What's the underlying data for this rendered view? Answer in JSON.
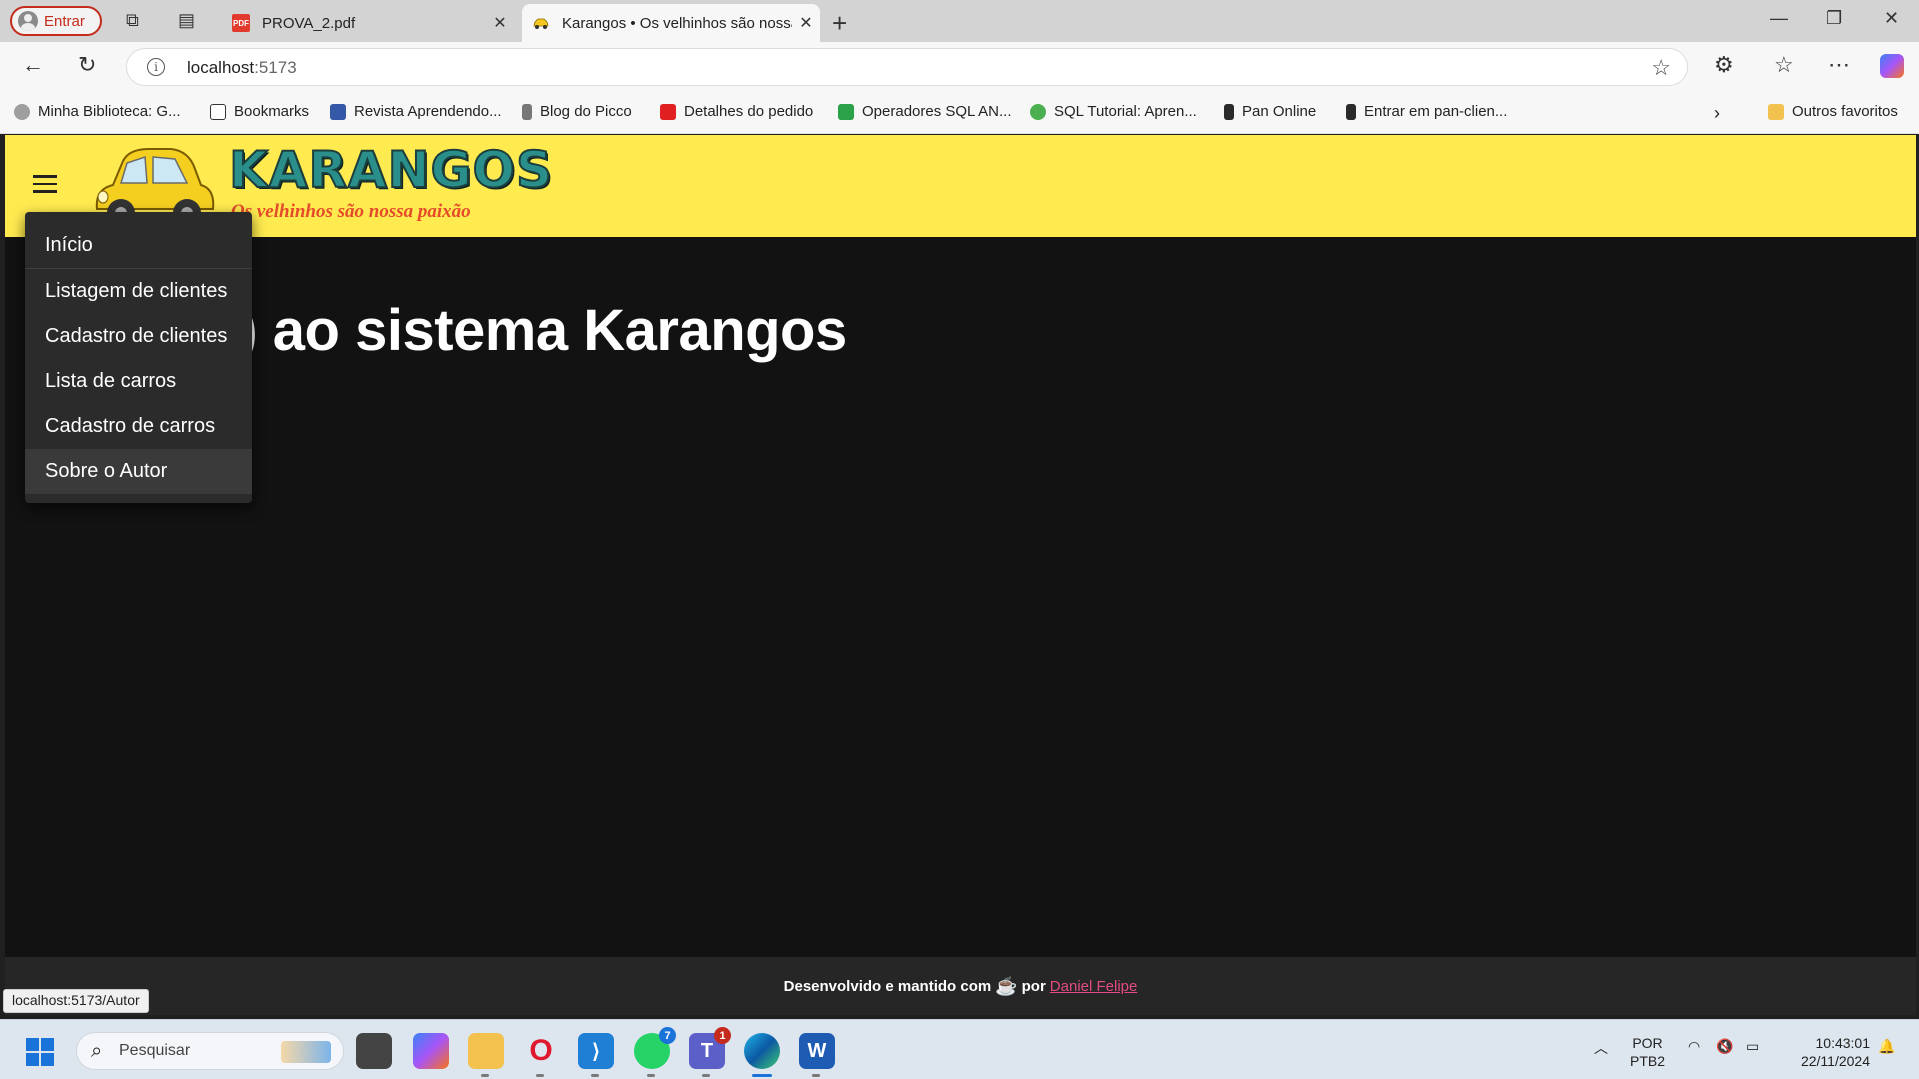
{
  "browser": {
    "profile_label": "Entrar",
    "tabs": [
      {
        "title": "PROVA_2.pdf",
        "favicon": "pdf-icon"
      },
      {
        "title": "Karangos • Os velhinhos são nossa paixão",
        "favicon": "car-icon"
      }
    ],
    "url_host": "localhost",
    "url_port": ":5173",
    "bookmarks": [
      {
        "label": "Minha Biblioteca: G...",
        "icon": "cloud-icon",
        "color": "#9e9e9e"
      },
      {
        "label": "Bookmarks",
        "icon": "page-icon",
        "color": "#ffffff"
      },
      {
        "label": "Revista Aprendendo...",
        "icon": "book-icon",
        "color": "#3559a8"
      },
      {
        "label": "Blog do Picco",
        "icon": "tower-icon",
        "color": "#777777"
      },
      {
        "label": "Detalhes do pedido",
        "icon": "store-icon",
        "color": "#e02020"
      },
      {
        "label": "Operadores SQL AN...",
        "icon": "w3-icon",
        "color": "#2aa24a"
      },
      {
        "label": "SQL Tutorial: Apren...",
        "icon": "sql-icon",
        "color": "#4caf50"
      },
      {
        "label": "Pan Online",
        "icon": "p-icon",
        "color": "#2a2a2a"
      },
      {
        "label": "Entrar em pan-clien...",
        "icon": "p-icon",
        "color": "#2a2a2a"
      }
    ],
    "other_favorites": "Outros favoritos",
    "status_url": "localhost:5173/Autor"
  },
  "app": {
    "logo_title": "KARANGOS",
    "logo_subtitle": "Os velhinhos são nossa paixão",
    "welcome_visible": "ndo(a) ao sistema Karangos",
    "menu": [
      "Início",
      "Listagem de clientes",
      "Cadastro de clientes",
      "Lista de carros",
      "Cadastro de carros",
      "Sobre o Autor"
    ],
    "menu_hovered_index": 5,
    "footer_text": "Desenvolvido e mantido com",
    "footer_by": "por",
    "footer_author": "Daniel Felipe",
    "colors": {
      "appbar": "#ffeb4f",
      "background": "#121212",
      "link": "#e34a86"
    }
  },
  "taskbar": {
    "search_placeholder": "Pesquisar",
    "teams_badge": "1",
    "whatsapp_badge": "7",
    "lang_line1": "POR",
    "lang_line2": "PTB2",
    "time": "10:43:01",
    "date": "22/11/2024"
  }
}
